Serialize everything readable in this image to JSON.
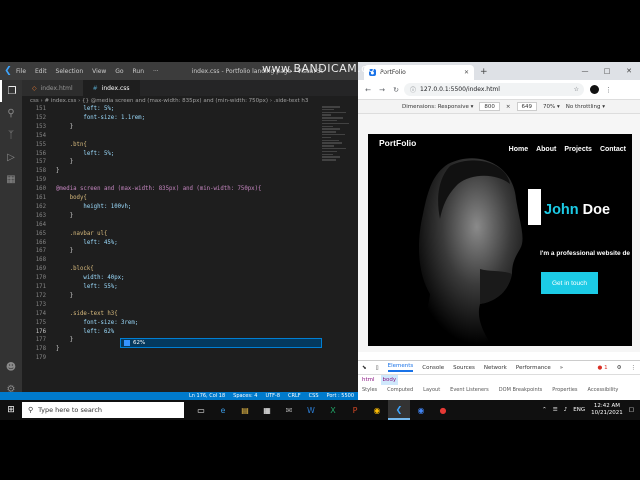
{
  "watermark": "www.BANDICAM.com",
  "vscode": {
    "menu": [
      "File",
      "Edit",
      "Selection",
      "View",
      "Go",
      "Run",
      "···"
    ],
    "window_title": "index.css - Portfolio landing page - Visual St",
    "tabs": [
      {
        "label": "index.html",
        "active": false
      },
      {
        "label": "index.css",
        "active": true
      }
    ],
    "breadcrumb": "css › # index.css › {} @media screen and (max-width: 835px) and (min-width: 750px) › .side-text h3",
    "lines": [
      {
        "n": "151",
        "text": "        left: 5%;"
      },
      {
        "n": "152",
        "text": "        font-size: 1.1rem;"
      },
      {
        "n": "153",
        "text": "    }"
      },
      {
        "n": "154",
        "text": ""
      },
      {
        "n": "155",
        "text": "    .btn{"
      },
      {
        "n": "156",
        "text": "        left: 5%;"
      },
      {
        "n": "157",
        "text": "    }"
      },
      {
        "n": "158",
        "text": "}"
      },
      {
        "n": "159",
        "text": ""
      },
      {
        "n": "160",
        "text": "@media screen and (max-width: 835px) and (min-width: 750px){"
      },
      {
        "n": "161",
        "text": "    body{"
      },
      {
        "n": "162",
        "text": "        height: 100vh;"
      },
      {
        "n": "163",
        "text": "    }"
      },
      {
        "n": "164",
        "text": ""
      },
      {
        "n": "165",
        "text": "    .navbar ul{"
      },
      {
        "n": "166",
        "text": "        left: 45%;"
      },
      {
        "n": "167",
        "text": "    }"
      },
      {
        "n": "168",
        "text": ""
      },
      {
        "n": "169",
        "text": "    .block{"
      },
      {
        "n": "170",
        "text": "        width: 40px;"
      },
      {
        "n": "171",
        "text": "        left: 55%;"
      },
      {
        "n": "172",
        "text": "    }"
      },
      {
        "n": "173",
        "text": ""
      },
      {
        "n": "174",
        "text": "    .side-text h3{"
      },
      {
        "n": "175",
        "text": "        font-size: 3rem;"
      },
      {
        "n": "176",
        "text": "        left: 62%"
      },
      {
        "n": "177",
        "text": "    }"
      },
      {
        "n": "178",
        "text": "}"
      },
      {
        "n": "179",
        "text": ""
      }
    ],
    "current_line": "176",
    "suggestion": "62%",
    "status": [
      "Ln 176, Col 18",
      "Spaces: 4",
      "UTF-8",
      "CRLF",
      "CSS",
      "Port : 5500"
    ]
  },
  "browser": {
    "tab_title": "PortFolio",
    "url": "127.0.0.1:5500/index.html",
    "device": {
      "dimensions_label": "Dimensions: Responsive ▾",
      "width": "800",
      "x": "×",
      "height": "649",
      "zoom": "70% ▾",
      "throttle": "No throttling ▾"
    },
    "site": {
      "logo": "PortFolio",
      "nav": [
        "Home",
        "About",
        "Projects",
        "Contact"
      ],
      "first_name": "John",
      "last_name": "Doe",
      "tagline": "I'm a professional website de",
      "cta": "Get in touch",
      "accent": "#1ccbe6"
    },
    "devtools": {
      "tabs": [
        "Elements",
        "Console",
        "Sources",
        "Network",
        "Performance",
        "»"
      ],
      "error_count": "● 1",
      "crumbs": [
        "html",
        "body"
      ],
      "sub": [
        "Styles",
        "Computed",
        "Layout",
        "Event Listeners",
        "DOM Breakpoints",
        "Properties",
        "Accessibility"
      ]
    }
  },
  "taskbar": {
    "search_placeholder": "Type here to search",
    "lang": "ENG",
    "time": "12:42 AM",
    "date": "10/21/2021"
  }
}
